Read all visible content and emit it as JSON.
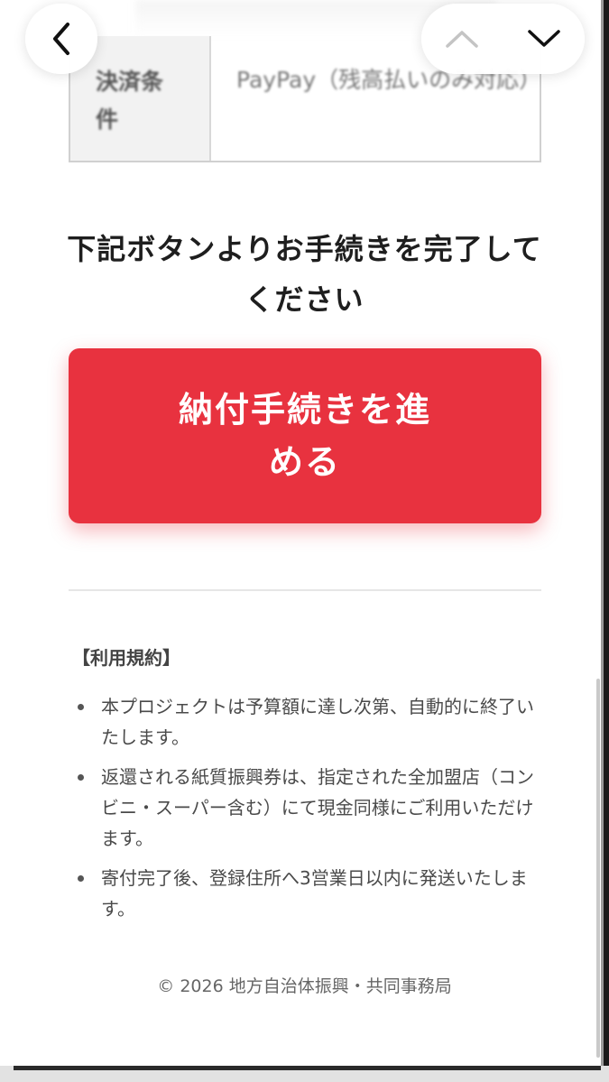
{
  "table": {
    "header": "決済条件",
    "value": "PayPay（残高払いのみ対応）"
  },
  "instruction": "下記ボタンよりお手続きを完了してください",
  "proceed_button": "納付手続きを進める",
  "terms": {
    "title": "【利用規約】",
    "items": [
      "本プロジェクトは予算額に達し次第、自動的に終了いたします。",
      "返還される紙質振興券は、指定された全加盟店（コンビニ・スーパー含む）にて現金同様にご利用いただけます。",
      "寄付完了後、登録住所へ3営業日以内に発送いたします。"
    ]
  },
  "footer": "© 2026 地方自治体振興・共同事務局",
  "icons": {
    "back": "chevron-left-icon",
    "previous": "chevron-up-icon",
    "next": "chevron-down-icon"
  },
  "colors": {
    "accent": "#e8323f",
    "text": "#1e1e1e",
    "muted": "#4a4a4a"
  }
}
